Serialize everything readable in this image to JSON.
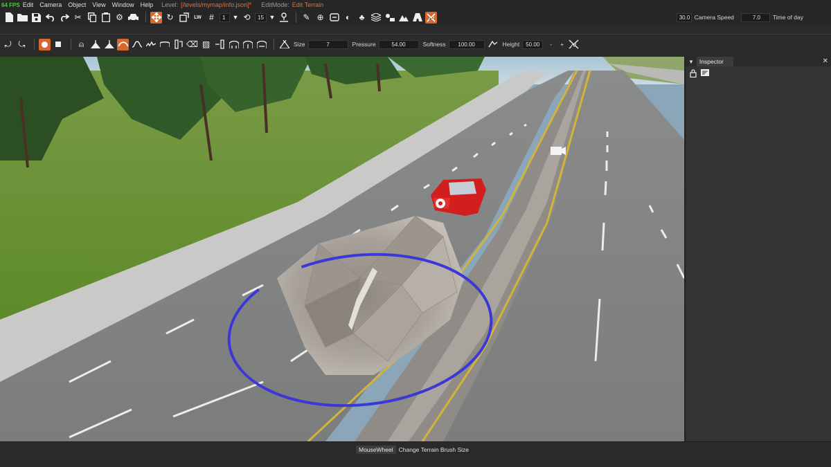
{
  "fps": "64 FPS",
  "menu": [
    "Edit",
    "Camera",
    "Object",
    "View",
    "Window",
    "Help"
  ],
  "level_label": "Level:",
  "level_path": "[/levels/mymap/info.json]*",
  "editmode_label": "EditMode:",
  "editmode_value": "Edit Terrain",
  "toolbar1": {
    "grid_value": "1",
    "rotate_value": "15",
    "camera_speed_value": "30.0",
    "camera_speed_label": "Camera Speed",
    "time_of_day_value": "7.0",
    "time_of_day_label": "Time of day"
  },
  "toolbar2": {
    "size_label": "Size",
    "size_value": "7",
    "pressure_label": "Pressure",
    "pressure_value": "54.00",
    "softness_label": "Softness",
    "softness_value": "100.00",
    "height_label": "Height",
    "height_value": "50.00",
    "minus": "-",
    "plus": "+"
  },
  "inspector": {
    "title": "Inspector",
    "close": "✕"
  },
  "status": {
    "key": "MouseWheel",
    "text": "Change Terrain Brush Size"
  },
  "colors": {
    "accent": "#d6682f",
    "brush_ring": "#3c38d6",
    "fps": "#41d343",
    "car": "#d21e1e"
  }
}
